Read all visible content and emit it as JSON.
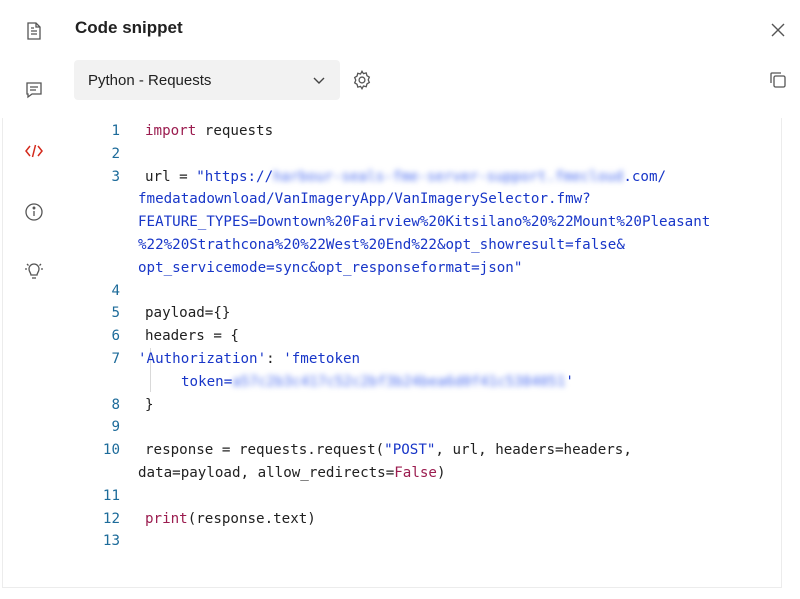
{
  "header": {
    "title": "Code snippet"
  },
  "sidebar": {
    "items": [
      "documentation",
      "comments",
      "code",
      "info",
      "suggestions"
    ]
  },
  "language_select": {
    "value": "Python - Requests"
  },
  "code": {
    "line_numbers": [
      "1",
      "2",
      "3",
      "4",
      "5",
      "6",
      "7",
      "8",
      "9",
      "10",
      "11",
      "12",
      "13"
    ],
    "l1_kw": "import",
    "l1_rest": " requests",
    "l3_a": "url = ",
    "l3_b": "\"https://",
    "l3_blur": "harbour-seals-fme-server-support.fmecloud",
    "l3_c": ".com/",
    "l3_d": "fmedatadownload/VanImageryApp/VanImagerySelector.fmw?",
    "l3_e": "FEATURE_TYPES=Downtown%20Fairview%20Kitsilano%20%22Mount%20Pleasant",
    "l3_f": "%22%20Strathcona%20%22West%20End%22&opt_showresult=false&",
    "l3_g": "opt_servicemode=sync&opt_responseformat=json\"",
    "l5": "payload={}",
    "l6": "headers = {",
    "l7_a": "'Authorization'",
    "l7_b": ": ",
    "l7_c": "'fmetoken",
    "l7_d": "token=",
    "l7_blur": "a57c2b3c417c52c2bf3b24bea6d0f41c5384051",
    "l7_e": "'",
    "l8": "}",
    "l10_a": "response = requests.request(",
    "l10_b": "\"POST\"",
    "l10_c": ", url, headers=headers,",
    "l10_d": "data=payload, allow_redirects=",
    "l10_e": "False",
    "l10_f": ")",
    "l12_a": "print",
    "l12_b": "(response.text)"
  },
  "colors": {
    "keyword": "#9b1c4f",
    "string": "#1836c8",
    "line_number": "#1d6b9a",
    "active_sidebar": "#d42a1c"
  }
}
